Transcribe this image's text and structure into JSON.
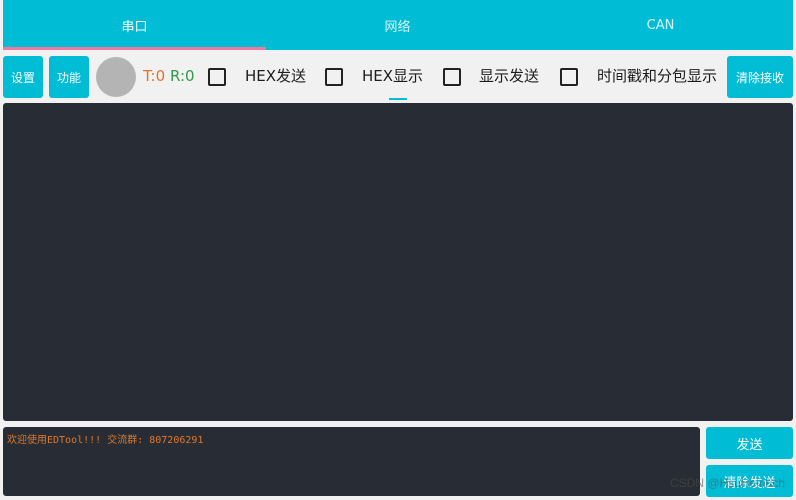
{
  "tabs": [
    {
      "label": "串口",
      "active": true
    },
    {
      "label": "网络",
      "active": false
    },
    {
      "label": "CAN",
      "active": false
    }
  ],
  "toolbar": {
    "settings_label": "设置",
    "function_label": "功能",
    "tx_counter": "T:0",
    "rx_counter": "R:0",
    "options": [
      {
        "label": "HEX发送",
        "checked": false
      },
      {
        "label": "HEX显示",
        "checked": false
      },
      {
        "label": "显示发送",
        "checked": false
      },
      {
        "label": "时间戳和分包显示",
        "checked": false
      }
    ],
    "clear_receive_label": "清除接收"
  },
  "send": {
    "text": "欢迎使用EDTool!!! 交流群: 807206291",
    "send_label": "发送",
    "clear_send_label": "清除发送"
  },
  "watermark": "CSDN @HsuHeinrich",
  "colors": {
    "accent": "#00bcd4",
    "tab_indicator": "#ee7aa0",
    "terminal_bg": "#282c34",
    "tx_color": "#e0722a",
    "rx_color": "#2e9a4a"
  }
}
